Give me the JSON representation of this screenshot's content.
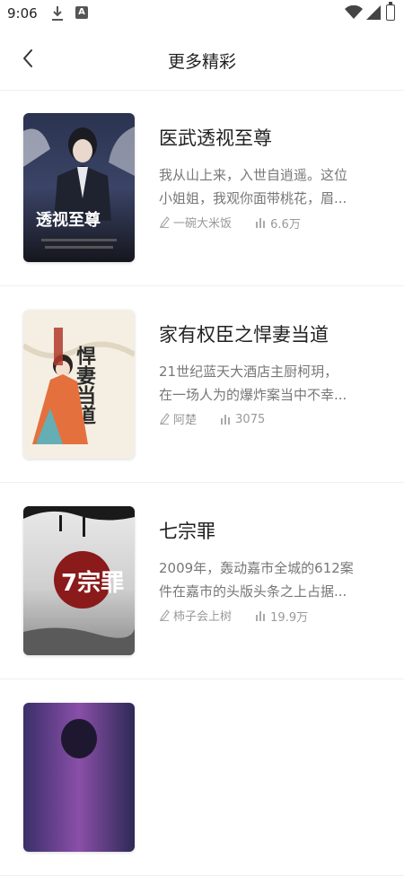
{
  "status": {
    "time": "9:06"
  },
  "header": {
    "title": "更多精彩"
  },
  "books": [
    {
      "title": "医武透视至尊",
      "desc_line1": "我从山上来，入世自逍遥。这位",
      "desc_line2": "小姐姐，我观你面带桃花，眉...",
      "author": "一碗大米饭",
      "reads": "6.6万",
      "cover_text": "透视至尊"
    },
    {
      "title": "家有权臣之悍妻当道",
      "desc_line1": "21世纪蓝天大酒店主厨柯玥，",
      "desc_line2": "在一场人为的爆炸案当中不幸...",
      "author": "阿楚",
      "reads": "3075",
      "cover_text": "悍妻当道"
    },
    {
      "title": "七宗罪",
      "desc_line1": "2009年，轰动嘉市全城的612案",
      "desc_line2": "件在嘉市的头版头条之上占据...",
      "author": "柿子会上树",
      "reads": "19.9万",
      "cover_text": "7宗罪"
    },
    {
      "title": "",
      "desc_line1": "",
      "desc_line2": "",
      "author": "",
      "reads": "",
      "cover_text": ""
    }
  ],
  "icons": {
    "back": "chevron-left-icon",
    "author": "pen-icon",
    "reads": "bar-chart-icon",
    "download": "download-icon",
    "wifi": "wifi-icon",
    "signal": "signal-icon",
    "battery": "battery-icon"
  }
}
